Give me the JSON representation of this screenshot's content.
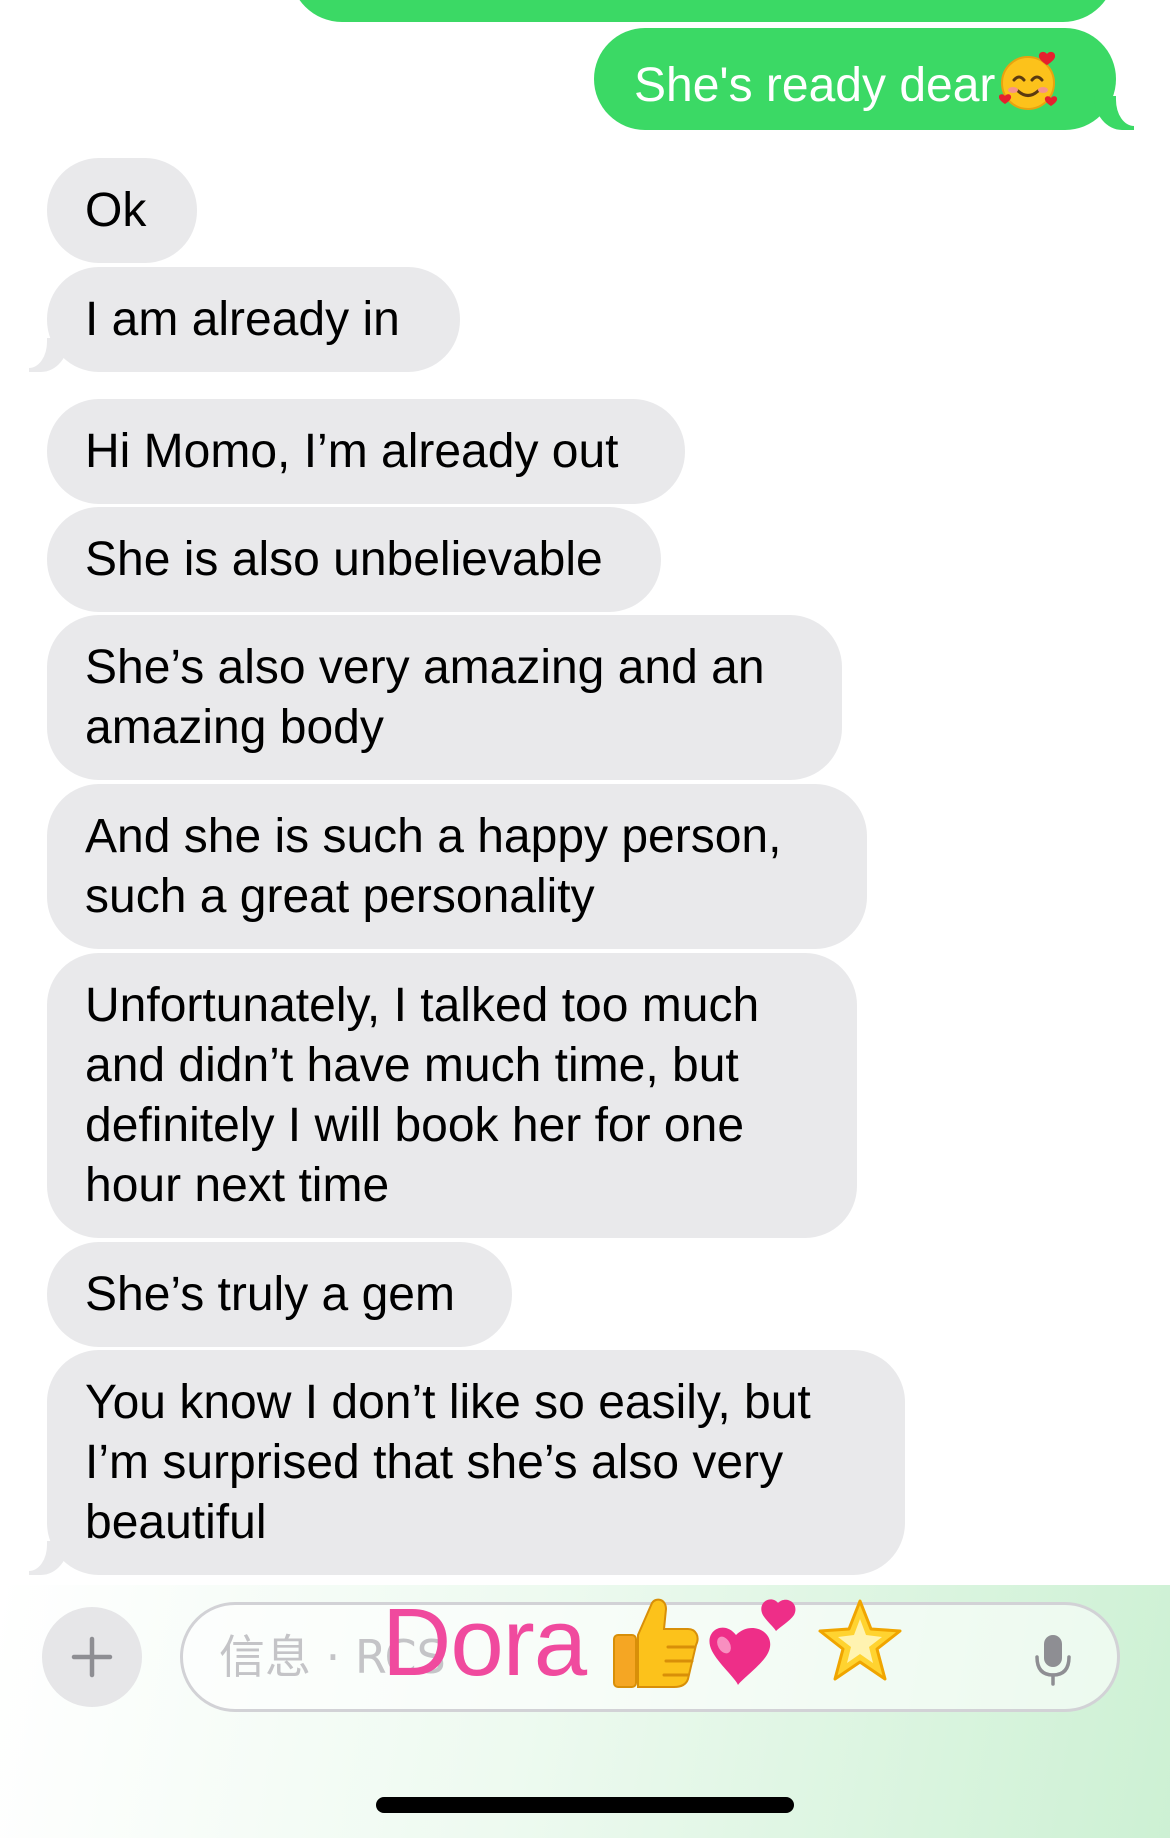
{
  "colors": {
    "outgoing_bubble": "#3bd965",
    "incoming_bubble": "#e9e9eb",
    "overlay_text": "#f04a9e",
    "background": "#ffffff"
  },
  "messages": [
    {
      "direction": "outgoing",
      "text": "She's ready dear",
      "emoji": "smiling-face-with-hearts"
    },
    {
      "direction": "incoming",
      "text": "Ok"
    },
    {
      "direction": "incoming",
      "text": "I am already in"
    },
    {
      "direction": "incoming",
      "text": "Hi Momo, I’m already out"
    },
    {
      "direction": "incoming",
      "text": "She is also unbelievable"
    },
    {
      "direction": "incoming",
      "lines": [
        "She’s also very amazing and an",
        "amazing body"
      ]
    },
    {
      "direction": "incoming",
      "lines": [
        "And she is such a happy person,",
        "such a great personality"
      ]
    },
    {
      "direction": "incoming",
      "lines": [
        "Unfortunately, I talked too much",
        "and didn’t have much time, but",
        "definitely I will book her for one",
        "hour next time"
      ]
    },
    {
      "direction": "incoming",
      "text": "She’s truly a gem"
    },
    {
      "direction": "incoming",
      "lines": [
        "You know I don’t like so easily, but",
        "I’m surprised that she’s also very",
        "beautiful"
      ]
    }
  ],
  "composer": {
    "placeholder": "信息 · RCS",
    "left_icon": "plus-icon",
    "right_icon": "microphone-icon"
  },
  "overlay": {
    "text": "Dora",
    "emojis": [
      "thumbs-up-icon",
      "two-hearts-icon",
      "glowing-star-icon"
    ]
  }
}
